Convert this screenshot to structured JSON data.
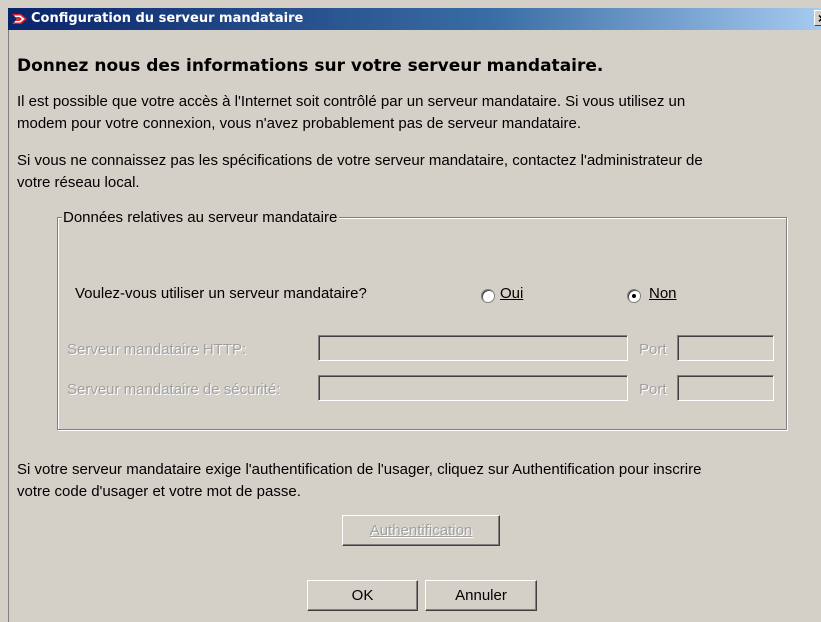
{
  "window": {
    "title": "Configuration du serveur mandataire",
    "close_label": "×",
    "app_icon": "canada-arrow-icon"
  },
  "heading": "Donnez nous des informations sur votre serveur mandataire.",
  "paragraphs": {
    "p1_line1": "Il est possible que votre accès à l'Internet soit contrôlé par un serveur mandataire.  Si vous utilisez un",
    "p1_line2": "modem pour votre connexion, vous n'avez probablement pas de serveur mandataire.",
    "p2_line1": "Si vous ne connaissez pas les spécifications de votre serveur mandataire, contactez l'administrateur de",
    "p2_line2": "votre réseau local.",
    "p3_line1": "Si votre serveur mandataire exige l'authentification de l'usager, cliquez sur Authentification pour inscrire",
    "p3_line2": "votre code d'usager et votre mot de passe."
  },
  "proxy_group": {
    "label": "Données relatives au serveur mandataire",
    "question": "Voulez-vous utiliser un serveur mandataire?",
    "option_yes": {
      "label": "Oui",
      "selected": false
    },
    "option_no": {
      "label": "Non",
      "selected": true
    },
    "http_label": "Serveur mandataire HTTP:",
    "http_value": "",
    "http_port_label": "Port",
    "http_port_value": "",
    "secure_label": "Serveur mandataire de sécurité:",
    "secure_value": "",
    "secure_port_label": "Port",
    "secure_port_value": ""
  },
  "buttons": {
    "auth": "Authentification",
    "ok": "OK",
    "cancel": "Annuler"
  }
}
